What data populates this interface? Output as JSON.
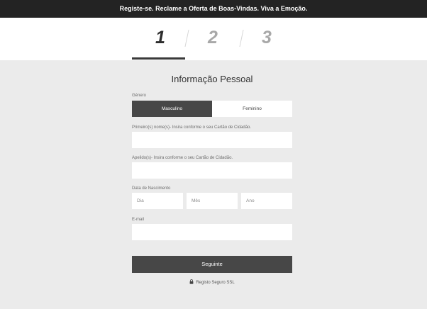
{
  "banner": {
    "text": "Registe-se. Reclame a Oferta de Boas-Vindas. Viva a Emoção."
  },
  "steps": [
    {
      "number": "1"
    },
    {
      "number": "2"
    },
    {
      "number": "3"
    }
  ],
  "form": {
    "title": "Informação Pessoal",
    "gender": {
      "label": "Género",
      "options": [
        {
          "label": "Masculino"
        },
        {
          "label": "Feminino"
        }
      ],
      "selected": "Masculino"
    },
    "first_name": {
      "label": "Primeiro(s) nome(s)- Insira conforme o seu Cartão de Cidadão."
    },
    "last_name": {
      "label": "Apelido(s)- Insira conforme o seu Cartão de Cidadão."
    },
    "birth_date": {
      "label": "Data de Nascimento",
      "day_placeholder": "Dia",
      "month_placeholder": "Mês",
      "year_placeholder": "Ano"
    },
    "email": {
      "label": "E-mail"
    },
    "next_label": "Seguinte",
    "ssl_label": "Registo Seguro SSL"
  },
  "icons": {
    "ssl": "lock-icon"
  },
  "colors": {
    "banner_bg": "#232323",
    "active_step": "#2d2d2d",
    "inactive_step": "#a8a8a8",
    "button_bg": "#474747",
    "page_bg": "#ebebeb"
  }
}
